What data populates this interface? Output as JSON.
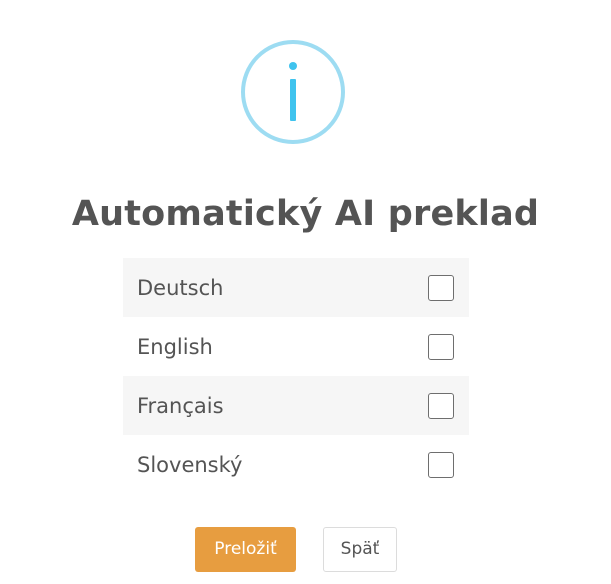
{
  "dialog": {
    "icon": "info-icon",
    "title": "Automatický AI preklad",
    "languages": [
      {
        "label": "Deutsch",
        "checked": false
      },
      {
        "label": "English",
        "checked": false
      },
      {
        "label": "Français",
        "checked": false
      },
      {
        "label": "Slovenský",
        "checked": false
      }
    ],
    "buttons": {
      "translate": "Preložiť",
      "back": "Späť"
    }
  },
  "colors": {
    "icon_ring": "#9ddcf2",
    "icon_glyph": "#3fc3ee",
    "title_text": "#545454",
    "row_shade": "#f6f6f6",
    "primary_button": "#e79d40"
  }
}
